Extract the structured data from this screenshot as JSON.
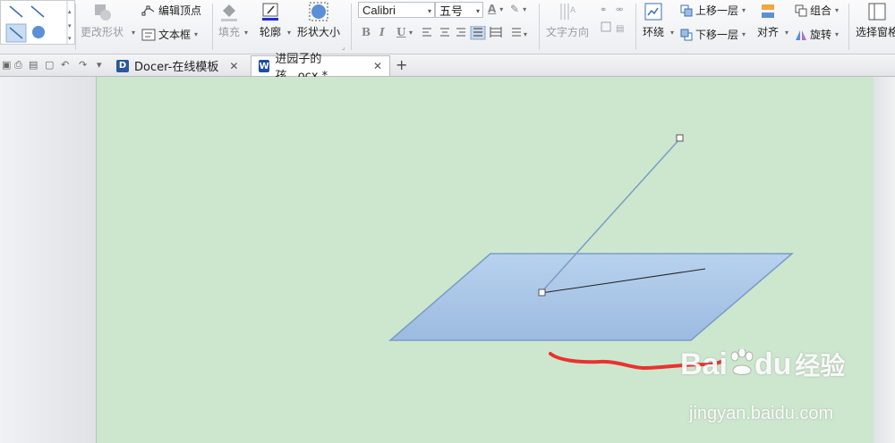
{
  "ribbon": {
    "change_shape": "更改形状",
    "edit_points": "编辑顶点",
    "text_box": "文本框",
    "fill": "填充",
    "outline": "轮廓",
    "shape_size": "形状大小",
    "font_name": "Calibri",
    "font_size": "五号",
    "text_direction": "文字方向",
    "wrap": "环绕",
    "bring_forward": "上移一层",
    "send_backward": "下移一层",
    "align": "对齐",
    "group": "组合",
    "rotate": "旋转",
    "selection_pane": "选择窗格",
    "format_buttons": [
      "B",
      "I",
      "U"
    ]
  },
  "tabs": [
    {
      "label": "Docer-在线模板",
      "icon": "docer-icon"
    },
    {
      "label": "进园子的孩...ocx *",
      "icon": "word-doc-icon"
    }
  ],
  "new_tab_symbol": "+",
  "close_symbol": "✕",
  "watermark": {
    "brand": "Bai",
    "brand2": "du",
    "cn": "经验",
    "url": "jingyan.baidu.com"
  },
  "colors": {
    "page_background": "#cde7cf",
    "parallelogram_top": "#b5cfec",
    "parallelogram_bottom": "#9dbde0",
    "line": "#7a9cc4",
    "red_stroke": "#e8332f"
  }
}
